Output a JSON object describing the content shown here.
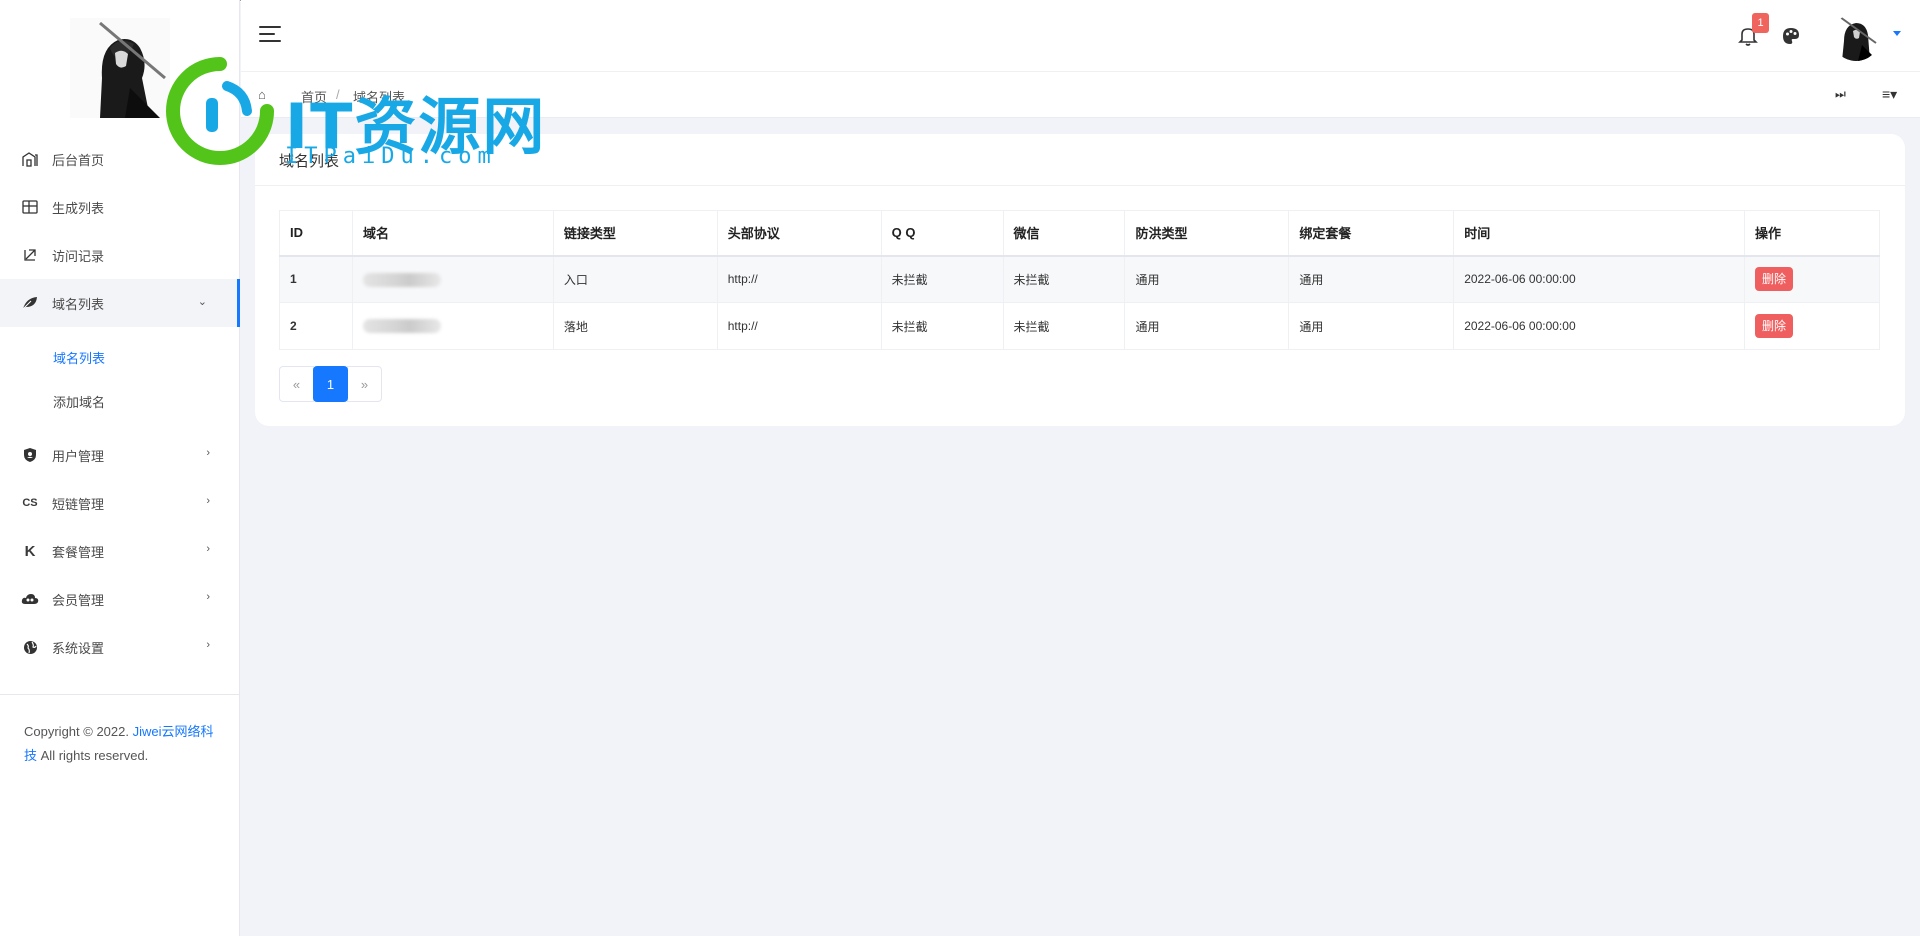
{
  "sidebar": {
    "items": [
      {
        "label": "后台首页",
        "icon": "home-icon",
        "has_chevron": false
      },
      {
        "label": "生成列表",
        "icon": "table-icon",
        "has_chevron": false
      },
      {
        "label": "访问记录",
        "icon": "arrow-down-left-icon",
        "has_chevron": false
      },
      {
        "label": "域名列表",
        "icon": "leaf-icon",
        "has_chevron": true,
        "open": true,
        "submenu": [
          {
            "label": "域名列表",
            "active": true
          },
          {
            "label": "添加域名",
            "active": false
          }
        ]
      },
      {
        "label": "用户管理",
        "icon": "shield-icon",
        "has_chevron": true
      },
      {
        "label": "短链管理",
        "icon": "link-icon",
        "has_chevron": true
      },
      {
        "label": "套餐管理",
        "icon": "k-icon",
        "has_chevron": true
      },
      {
        "label": "会员管理",
        "icon": "cloud-icon",
        "has_chevron": true
      },
      {
        "label": "系统设置",
        "icon": "globe-icon",
        "has_chevron": true
      }
    ],
    "copyright_prefix": "Copyright © 2022.",
    "copyright_link": "Jiwei云网络科技",
    "copyright_suffix": "All rights reserved."
  },
  "header": {
    "notification_count": "1",
    "bell_icon": "bell-icon",
    "palette_icon": "palette-icon"
  },
  "breadcrumb": {
    "items": [
      "首页",
      "域名列表"
    ],
    "right_icons": [
      "⏭",
      "≡▾"
    ]
  },
  "card": {
    "title": "域名列表"
  },
  "table": {
    "columns": [
      "ID",
      "域名",
      "链接类型",
      "头部协议",
      "Q Q",
      "微信",
      "防洪类型",
      "绑定套餐",
      "时间",
      "操作"
    ],
    "rows": [
      {
        "id": "1",
        "domain": "",
        "link_type": "入口",
        "protocol": "http://",
        "qq": "未拦截",
        "wechat": "未拦截",
        "flood_type": "通用",
        "package": "通用",
        "time": "2022-06-06 00:00:00",
        "action": "删除"
      },
      {
        "id": "2",
        "domain": "",
        "link_type": "落地",
        "protocol": "http://",
        "qq": "未拦截",
        "wechat": "未拦截",
        "flood_type": "通用",
        "package": "通用",
        "time": "2022-06-06 00:00:00",
        "action": "删除"
      }
    ]
  },
  "pagination": {
    "prev": "«",
    "current": "1",
    "next": "»"
  },
  "watermark": {
    "title": "IT资源网",
    "subtitle": "ITPaiDu.com"
  },
  "colors": {
    "accent": "#1677ff",
    "danger": "#ef5f5f",
    "success": "#1a8a2c",
    "watermark": "#19a8e6",
    "watermark_ring": "#52c41a"
  }
}
